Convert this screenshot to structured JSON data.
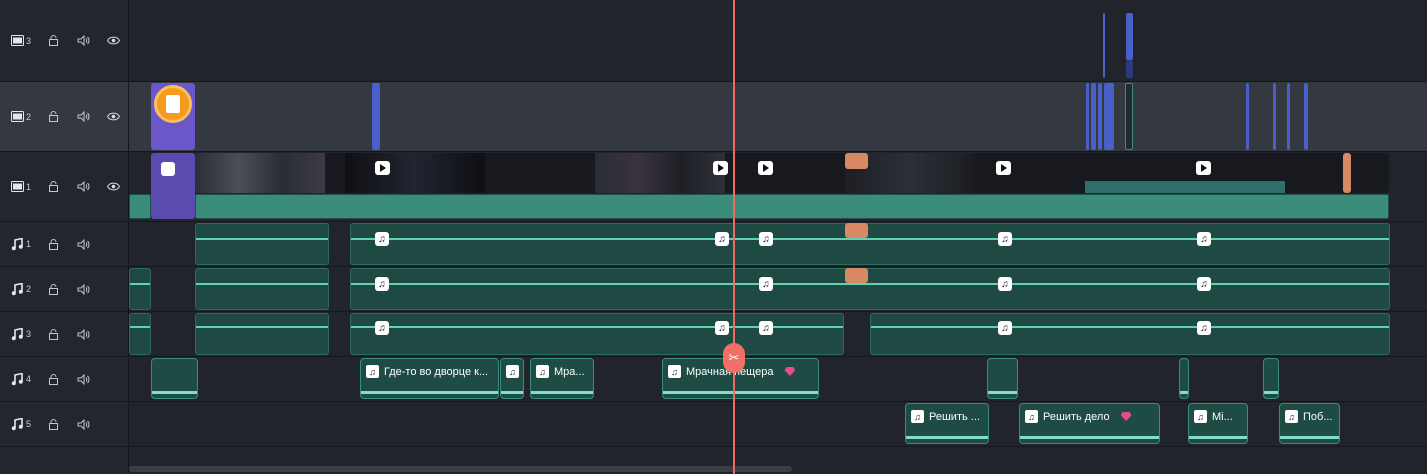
{
  "tracks": [
    {
      "id": "v3",
      "type": "video",
      "number": "3",
      "icon": "video-track-icon"
    },
    {
      "id": "v2",
      "type": "video",
      "number": "2",
      "icon": "video-track-icon"
    },
    {
      "id": "v1",
      "type": "video",
      "number": "1",
      "icon": "video-track-icon"
    },
    {
      "id": "a1",
      "type": "audio",
      "number": "1",
      "icon": "music-track-icon"
    },
    {
      "id": "a2",
      "type": "audio",
      "number": "2",
      "icon": "music-track-icon"
    },
    {
      "id": "a3",
      "type": "audio",
      "number": "3",
      "icon": "music-track-icon"
    },
    {
      "id": "a4",
      "type": "audio",
      "number": "4",
      "icon": "music-track-icon"
    },
    {
      "id": "a5",
      "type": "audio",
      "number": "5",
      "icon": "music-track-icon"
    }
  ],
  "music_clips": {
    "c1": "Где-то во дворце к...",
    "c2": "",
    "c3": "Мра...",
    "c4": "Мрачная пещера",
    "c5": "Решить ...",
    "c6": "Решить дело",
    "c7": "Mi...",
    "c8": "Поб..."
  },
  "colors": {
    "playhead": "#f06a63",
    "clip_green": "#3c8c7a",
    "marker_blue": "#4a5fc8",
    "premium_gem": "#e84c8a"
  }
}
